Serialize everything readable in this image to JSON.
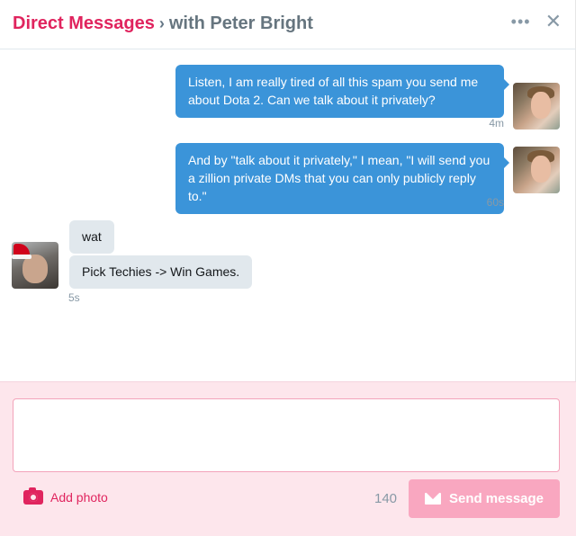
{
  "header": {
    "title": "Direct Messages",
    "separator": "›",
    "subtitle": "with Peter Bright",
    "more_icon": "more-horizontal-icon",
    "more_glyph": "•••",
    "close_icon": "close-icon",
    "close_glyph": "✕"
  },
  "messages": [
    {
      "direction": "outgoing",
      "text": "Listen, I am really tired of all this spam you send me about Dota 2. Can we talk about it privately?",
      "time": "4m"
    },
    {
      "direction": "outgoing",
      "text": "And by \"talk about it privately,\" I mean, \"I will send you a zillion private DMs that you can only publicly reply to.\"",
      "time": "60s"
    },
    {
      "direction": "incoming",
      "text": "wat"
    },
    {
      "direction": "incoming",
      "text": "Pick Techies -> Win Games.",
      "time": "5s"
    }
  ],
  "composer": {
    "input_value": "",
    "add_photo_label": "Add photo",
    "camera_icon": "camera-icon",
    "char_count": "140",
    "send_label": "Send message",
    "send_icon": "envelope-icon"
  },
  "colors": {
    "accent": "#e0245e",
    "outgoing_bubble": "#3b94d9",
    "incoming_bubble": "#e1e8ed",
    "composer_bg": "#fde6ec",
    "send_disabled": "#f9a7c0"
  }
}
